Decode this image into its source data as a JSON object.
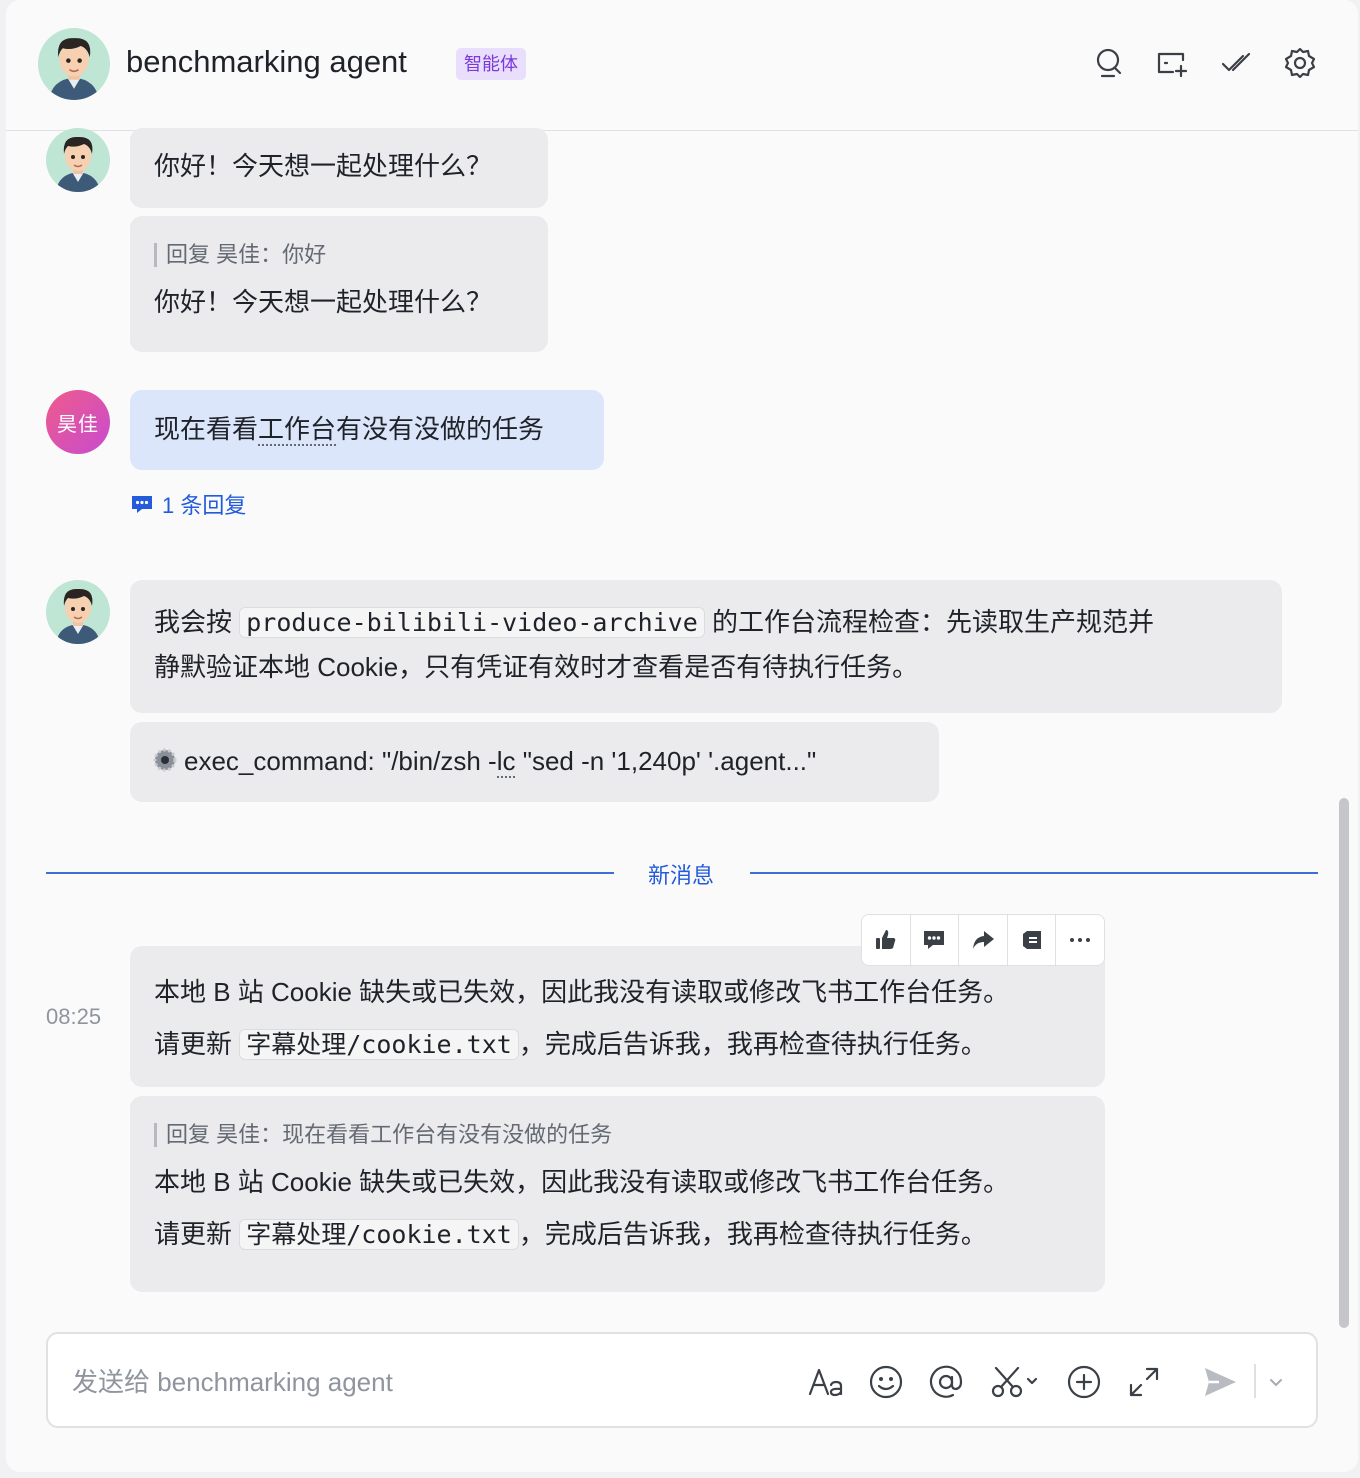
{
  "header": {
    "title": "benchmarking agent",
    "badge": "智能体",
    "icons": [
      "search-chat-icon",
      "add-to-board-icon",
      "task-check-icon",
      "settings-gear-icon"
    ]
  },
  "messages": [
    {
      "sender": "bot",
      "text": "你好！今天想一起处理什么？"
    },
    {
      "sender": "bot",
      "quote": "回复 昊佳：你好",
      "text": "你好！今天想一起处理什么？"
    },
    {
      "sender": "user",
      "avatar_text": "昊佳",
      "text_before": "现在看看",
      "text_dotted": "工作台",
      "text_after": "有没有没做的任务",
      "reply_count": "1 条回复"
    },
    {
      "sender": "bot",
      "text_1": "我会按",
      "code": "produce-bilibili-video-archive",
      "text_2": "的工作台流程检查：先读取生产规范并",
      "text_3": "静默验证本地 Cookie，只有凭证有效时才查看是否有待执行任务。"
    },
    {
      "sender": "bot",
      "tool_before": "exec_command: \"/bin/zsh -",
      "tool_dotted": "lc",
      "tool_after": " \"sed -n '1,240p' '.agent...\""
    }
  ],
  "new_message_divider": "新消息",
  "latest": {
    "time": "08:25",
    "line1": "本地 B 站 Cookie 缺失或已失效，因此我没有读取或修改飞书工作台任务。",
    "line2_before": "请更新",
    "line2_code": "字幕处理/cookie.txt",
    "line2_after": "，完成后告诉我，我再检查待执行任务。",
    "quote": "回复 昊佳：现在看看工作台有没有没做的任务"
  },
  "hover_toolbar": [
    "thumbs-up-icon",
    "reply-bubble-icon",
    "forward-icon",
    "pin-icon",
    "more-icon"
  ],
  "composer": {
    "placeholder": "发送给 benchmarking agent",
    "icons": [
      "text-format-icon",
      "emoji-icon",
      "mention-icon",
      "screenshot-icon",
      "add-icon",
      "expand-icon",
      "send-icon",
      "send-options-icon"
    ]
  }
}
